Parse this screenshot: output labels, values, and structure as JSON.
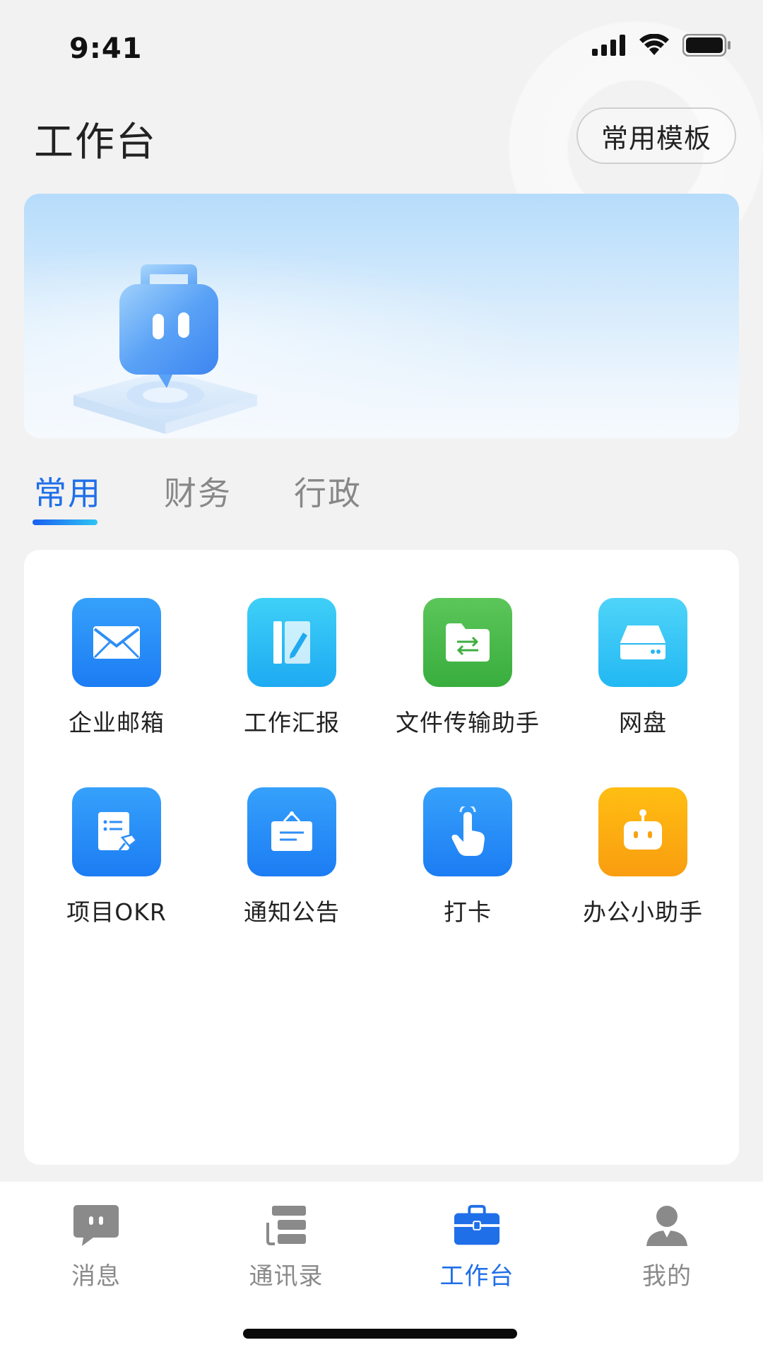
{
  "status_bar": {
    "time": "9:41"
  },
  "header": {
    "title": "工作台",
    "template_button": "常用模板"
  },
  "tabs": [
    {
      "label": "常用",
      "active": true
    },
    {
      "label": "财务",
      "active": false
    },
    {
      "label": "行政",
      "active": false
    }
  ],
  "apps": [
    {
      "label": "企业邮箱",
      "icon": "mail-icon",
      "color": "#1e86f5"
    },
    {
      "label": "工作汇报",
      "icon": "report-icon",
      "color": "#26b7f3"
    },
    {
      "label": "文件传输助手",
      "icon": "file-transfer-icon",
      "color": "#3eb74a"
    },
    {
      "label": "网盘",
      "icon": "cloud-drive-icon",
      "color": "#2ec4f5"
    },
    {
      "label": "项目OKR",
      "icon": "okr-icon",
      "color": "#1e86f5"
    },
    {
      "label": "通知公告",
      "icon": "announcement-icon",
      "color": "#1e86f5"
    },
    {
      "label": "打卡",
      "icon": "check-in-icon",
      "color": "#1e86f5"
    },
    {
      "label": "办公小助手",
      "icon": "robot-icon",
      "color": "#fba80f"
    }
  ],
  "bottom_nav": [
    {
      "label": "消息",
      "icon": "message-icon",
      "active": false
    },
    {
      "label": "通讯录",
      "icon": "contacts-icon",
      "active": false
    },
    {
      "label": "工作台",
      "icon": "briefcase-icon",
      "active": true
    },
    {
      "label": "我的",
      "icon": "profile-icon",
      "active": false
    }
  ],
  "colors": {
    "accent": "#1f6fe8",
    "inactive": "#8a8a8a",
    "background": "#f2f2f2"
  }
}
